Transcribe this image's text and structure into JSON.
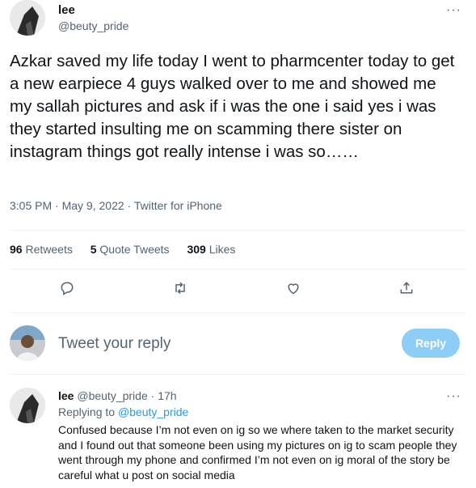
{
  "tweet": {
    "display_name": "lee",
    "handle": "@beuty_pride",
    "more_label": "···",
    "text": "Azkar saved my life today I went to pharmcenter today to get a new earpiece 4 guys walked over to me and showed me my sallah pictures and ask if i was the one i said yes i was they started insulting me on scamming there sister on instagram things got really intense i was so……",
    "time": "3:05 PM",
    "date": "May 9, 2022",
    "source": "Twitter for iPhone",
    "dot": " · "
  },
  "stats": {
    "retweets_count": "96",
    "retweets_label": "Retweets",
    "quotes_count": "5",
    "quotes_label": "Quote Tweets",
    "likes_count": "309",
    "likes_label": "Likes"
  },
  "actions": [
    "reply-icon",
    "retweet-icon",
    "like-icon",
    "share-icon"
  ],
  "composer": {
    "placeholder": "Tweet your reply",
    "button_label": "Reply",
    "button_color": "#8ecdf8"
  },
  "reply": {
    "display_name": "lee",
    "handle": "@beuty_pride",
    "age": "17h",
    "dot": " · ",
    "replying_prefix": "Replying to",
    "replying_to": "@beuty_pride",
    "more_label": "···",
    "text": "Confused because I’m not even on ig so we where taken to the market security and I found out that someone been using my pictures on ig to scam people they went through my phone and confirmed I’m not even on ig moral of the story be careful what u post on social media"
  },
  "colors": {
    "accent": "#1d9bf0",
    "secondary_text": "#536471",
    "divider": "#eff3f4"
  }
}
